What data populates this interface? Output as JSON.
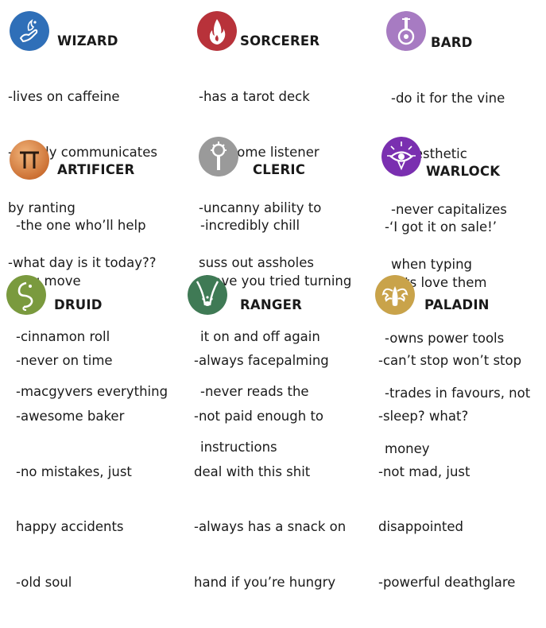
{
  "classes": [
    {
      "name": "WIZARD",
      "icon": "wizard-hand-icon",
      "color": "#2f6fb8",
      "lines": [
        "-lives on caffeine",
        "-mainly communicates",
        "by ranting",
        "-what day is it today??"
      ]
    },
    {
      "name": "SORCERER",
      "icon": "sorcerer-flame-icon",
      "color": "#b8323a",
      "lines": [
        "-has a tarot deck",
        "-awesome listener",
        "-uncanny ability to",
        "suss out assholes"
      ]
    },
    {
      "name": "BARD",
      "icon": "bard-lute-icon",
      "color": "#a77bc2",
      "lines": [
        "-do it for the vine",
        "-#aesthetic",
        "-never capitalizes",
        "when typing"
      ]
    },
    {
      "name": "ARTIFICER",
      "icon": "artificer-gear-icon",
      "color": "#d47a36",
      "lines": [
        "-the one who’ll help",
        "you move",
        "-cinnamon roll",
        "-macgyvers everything"
      ]
    },
    {
      "name": "CLERIC",
      "icon": "cleric-mace-icon",
      "color": "#9a9a9a",
      "lines": [
        "-incredibly chill",
        "-have you tried turning",
        "it on and off again",
        "-never reads the",
        "instructions"
      ]
    },
    {
      "name": "WARLOCK",
      "icon": "warlock-eye-icon",
      "color": "#7a2fb0",
      "lines": [
        "-‘I got it on sale!’",
        "-cats love them",
        "-owns power tools",
        "-trades in favours, not",
        "money"
      ]
    },
    {
      "name": "DRUID",
      "icon": "druid-leaf-icon",
      "color": "#7a9a3e",
      "lines": [
        "-never on time",
        "-awesome baker",
        "-no mistakes, just",
        "happy accidents",
        "-old soul"
      ]
    },
    {
      "name": "RANGER",
      "icon": "ranger-paw-icon",
      "color": "#3f7a55",
      "lines": [
        "-always facepalming",
        "-not paid enough to",
        "deal with this shit",
        "-always has a snack on",
        "hand if you’re hungry"
      ]
    },
    {
      "name": "PALADIN",
      "icon": "paladin-wings-icon",
      "color": "#c9a34a",
      "lines": [
        "-can’t stop won’t stop",
        "-sleep? what?",
        "-not mad, just",
        "disappointed",
        "-powerful deathglare"
      ]
    }
  ]
}
